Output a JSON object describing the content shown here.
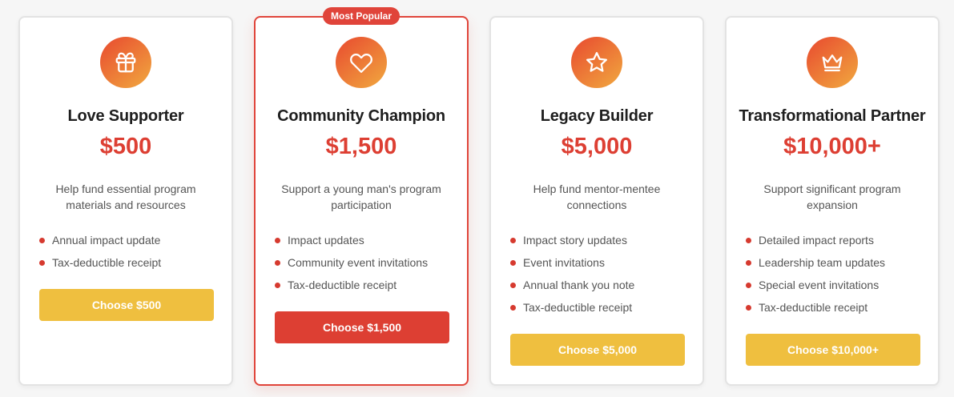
{
  "tiers": [
    {
      "icon": "gift-icon",
      "title": "Love Supporter",
      "price": "$500",
      "description": "Help fund essential program materials and resources",
      "benefits": [
        "Annual impact update",
        "Tax-deductible receipt"
      ],
      "cta": "Choose $500"
    },
    {
      "icon": "heart-icon",
      "badge": "Most Popular",
      "title": "Community Champion",
      "price": "$1,500",
      "description": "Support a young man's program participation",
      "benefits": [
        "Impact updates",
        "Community event invitations",
        "Tax-deductible receipt"
      ],
      "cta": "Choose $1,500"
    },
    {
      "icon": "star-icon",
      "title": "Legacy Builder",
      "price": "$5,000",
      "description": "Help fund mentor-mentee connections",
      "benefits": [
        "Impact story updates",
        "Event invitations",
        "Annual thank you note",
        "Tax-deductible receipt"
      ],
      "cta": "Choose $5,000"
    },
    {
      "icon": "crown-icon",
      "title": "Transformational Partner",
      "price": "$10,000+",
      "description": "Support significant program expansion",
      "benefits": [
        "Detailed impact reports",
        "Leadership team updates",
        "Special event invitations",
        "Tax-deductible receipt"
      ],
      "cta": "Choose $10,000+"
    }
  ],
  "colors": {
    "accent_red": "#dd3f33",
    "accent_gold": "#efbf3f",
    "icon_gradient_start": "#e8492f",
    "icon_gradient_end": "#f1a93f"
  }
}
